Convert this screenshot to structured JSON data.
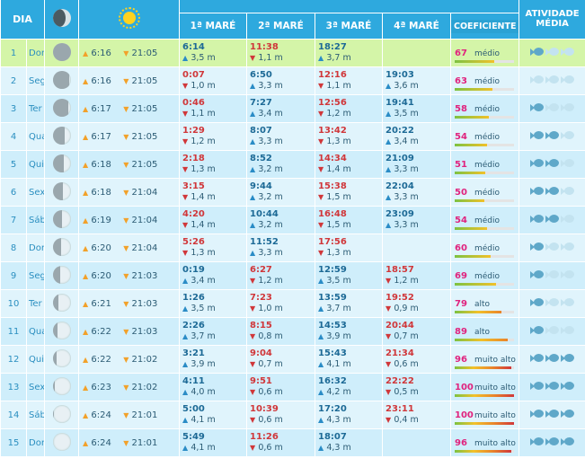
{
  "header": {
    "dia": "DIA",
    "sun_icon": "sun-icon",
    "moon_icon": "moon-icon",
    "tide_group": "",
    "tides": [
      "1ª MARÉ",
      "2ª MARÉ",
      "3ª MARÉ",
      "4ª MARÉ"
    ],
    "coeficiente": "COEFICIENTE",
    "atividade": "ATIVIDADE",
    "media": "MÉDIA"
  },
  "colors": {
    "header_bg": "#2ea9de",
    "row_bg": "#cfeefb",
    "row_alt_bg": "#e0f4fc",
    "today_bg": "#d4f5a8",
    "high_tide": "#1d6a96",
    "low_tide": "#d0373a",
    "coef_value": "#e0237e",
    "sun_arrow": "#f2a12a"
  },
  "rows": [
    {
      "num": "1",
      "wd": "Dom",
      "moon": 0.02,
      "rise": "6:16",
      "set": "21:05",
      "t": [
        {
          "time": "6:14",
          "h": "3,5 m",
          "type": "hi"
        },
        {
          "time": "11:38",
          "h": "1,1 m",
          "type": "lo"
        },
        {
          "time": "18:27",
          "h": "3,7 m",
          "type": "hi"
        },
        null
      ],
      "coef": "67",
      "level": "médio",
      "fish": 1
    },
    {
      "num": "2",
      "wd": "Seg",
      "moon": 0.08,
      "rise": "6:16",
      "set": "21:05",
      "t": [
        {
          "time": "0:07",
          "h": "1,0 m",
          "type": "lo"
        },
        {
          "time": "6:50",
          "h": "3,3 m",
          "type": "hi"
        },
        {
          "time": "12:16",
          "h": "1,1 m",
          "type": "lo"
        },
        {
          "time": "19:03",
          "h": "3,6 m",
          "type": "hi"
        }
      ],
      "coef": "63",
      "level": "médio",
      "fish": 0
    },
    {
      "num": "3",
      "wd": "Ter",
      "moon": 0.15,
      "rise": "6:17",
      "set": "21:05",
      "t": [
        {
          "time": "0:46",
          "h": "1,1 m",
          "type": "lo"
        },
        {
          "time": "7:27",
          "h": "3,4 m",
          "type": "hi"
        },
        {
          "time": "12:56",
          "h": "1,2 m",
          "type": "lo"
        },
        {
          "time": "19:41",
          "h": "3,5 m",
          "type": "hi"
        }
      ],
      "coef": "58",
      "level": "médio",
      "fish": 1
    },
    {
      "num": "4",
      "wd": "Qua",
      "moon": 0.35,
      "rise": "6:17",
      "set": "21:05",
      "t": [
        {
          "time": "1:29",
          "h": "1,2 m",
          "type": "lo"
        },
        {
          "time": "8:07",
          "h": "3,3 m",
          "type": "hi"
        },
        {
          "time": "13:42",
          "h": "1,3 m",
          "type": "lo"
        },
        {
          "time": "20:22",
          "h": "3,4 m",
          "type": "hi"
        }
      ],
      "coef": "54",
      "level": "médio",
      "fish": 2
    },
    {
      "num": "5",
      "wd": "Qui",
      "moon": 0.4,
      "rise": "6:18",
      "set": "21:05",
      "t": [
        {
          "time": "2:18",
          "h": "1,3 m",
          "type": "lo"
        },
        {
          "time": "8:52",
          "h": "3,2 m",
          "type": "hi"
        },
        {
          "time": "14:34",
          "h": "1,4 m",
          "type": "lo"
        },
        {
          "time": "21:09",
          "h": "3,3 m",
          "type": "hi"
        }
      ],
      "coef": "51",
      "level": "médio",
      "fish": 2
    },
    {
      "num": "6",
      "wd": "Sex",
      "moon": 0.45,
      "rise": "6:18",
      "set": "21:04",
      "t": [
        {
          "time": "3:15",
          "h": "1,4 m",
          "type": "lo"
        },
        {
          "time": "9:44",
          "h": "3,2 m",
          "type": "hi"
        },
        {
          "time": "15:38",
          "h": "1,5 m",
          "type": "lo"
        },
        {
          "time": "22:04",
          "h": "3,3 m",
          "type": "hi"
        }
      ],
      "coef": "50",
      "level": "médio",
      "fish": 2
    },
    {
      "num": "7",
      "wd": "Sáb",
      "moon": 0.5,
      "rise": "6:19",
      "set": "21:04",
      "t": [
        {
          "time": "4:20",
          "h": "1,4 m",
          "type": "lo"
        },
        {
          "time": "10:44",
          "h": "3,2 m",
          "type": "hi"
        },
        {
          "time": "16:48",
          "h": "1,5 m",
          "type": "lo"
        },
        {
          "time": "23:09",
          "h": "3,3 m",
          "type": "hi"
        }
      ],
      "coef": "54",
      "level": "médio",
      "fish": 2
    },
    {
      "num": "8",
      "wd": "Dom",
      "moon": 0.55,
      "rise": "6:20",
      "set": "21:04",
      "t": [
        {
          "time": "5:26",
          "h": "1,3 m",
          "type": "lo"
        },
        {
          "time": "11:52",
          "h": "3,3 m",
          "type": "hi"
        },
        {
          "time": "17:56",
          "h": "1,3 m",
          "type": "lo"
        },
        null
      ],
      "coef": "60",
      "level": "médio",
      "fish": 1
    },
    {
      "num": "9",
      "wd": "Seg",
      "moon": 0.6,
      "rise": "6:20",
      "set": "21:03",
      "t": [
        {
          "time": "0:19",
          "h": "3,4 m",
          "type": "hi"
        },
        {
          "time": "6:27",
          "h": "1,2 m",
          "type": "lo"
        },
        {
          "time": "12:59",
          "h": "3,5 m",
          "type": "hi"
        },
        {
          "time": "18:57",
          "h": "1,2 m",
          "type": "lo"
        }
      ],
      "coef": "69",
      "level": "médio",
      "fish": 1
    },
    {
      "num": "10",
      "wd": "Ter",
      "moon": 0.68,
      "rise": "6:21",
      "set": "21:03",
      "t": [
        {
          "time": "1:26",
          "h": "3,5 m",
          "type": "hi"
        },
        {
          "time": "7:23",
          "h": "1,0 m",
          "type": "lo"
        },
        {
          "time": "13:59",
          "h": "3,7 m",
          "type": "hi"
        },
        {
          "time": "19:52",
          "h": "0,9 m",
          "type": "lo"
        }
      ],
      "coef": "79",
      "level": "alto",
      "fish": 1
    },
    {
      "num": "11",
      "wd": "Qua",
      "moon": 0.75,
      "rise": "6:22",
      "set": "21:03",
      "t": [
        {
          "time": "2:26",
          "h": "3,7 m",
          "type": "hi"
        },
        {
          "time": "8:15",
          "h": "0,8 m",
          "type": "lo"
        },
        {
          "time": "14:53",
          "h": "3,9 m",
          "type": "hi"
        },
        {
          "time": "20:44",
          "h": "0,7 m",
          "type": "lo"
        }
      ],
      "coef": "89",
      "level": "alto",
      "fish": 1
    },
    {
      "num": "12",
      "wd": "Qui",
      "moon": 0.82,
      "rise": "6:22",
      "set": "21:02",
      "t": [
        {
          "time": "3:21",
          "h": "3,9 m",
          "type": "hi"
        },
        {
          "time": "9:04",
          "h": "0,7 m",
          "type": "lo"
        },
        {
          "time": "15:43",
          "h": "4,1 m",
          "type": "hi"
        },
        {
          "time": "21:34",
          "h": "0,6 m",
          "type": "lo"
        }
      ],
      "coef": "96",
      "level": "muito alto",
      "fish": 3
    },
    {
      "num": "13",
      "wd": "Sex",
      "moon": 0.88,
      "rise": "6:23",
      "set": "21:02",
      "t": [
        {
          "time": "4:11",
          "h": "4,0 m",
          "type": "hi"
        },
        {
          "time": "9:51",
          "h": "0,6 m",
          "type": "lo"
        },
        {
          "time": "16:32",
          "h": "4,2 m",
          "type": "hi"
        },
        {
          "time": "22:22",
          "h": "0,5 m",
          "type": "lo"
        }
      ],
      "coef": "100",
      "level": "muito alto",
      "fish": 3
    },
    {
      "num": "14",
      "wd": "Sáb",
      "moon": 0.94,
      "rise": "6:24",
      "set": "21:01",
      "t": [
        {
          "time": "5:00",
          "h": "4,1 m",
          "type": "hi"
        },
        {
          "time": "10:39",
          "h": "0,6 m",
          "type": "lo"
        },
        {
          "time": "17:20",
          "h": "4,3 m",
          "type": "hi"
        },
        {
          "time": "23:11",
          "h": "0,4 m",
          "type": "lo"
        }
      ],
      "coef": "100",
      "level": "muito alto",
      "fish": 3
    },
    {
      "num": "15",
      "wd": "Dom",
      "moon": 0.98,
      "rise": "6:24",
      "set": "21:01",
      "t": [
        {
          "time": "5:49",
          "h": "4,1 m",
          "type": "hi"
        },
        {
          "time": "11:26",
          "h": "0,6 m",
          "type": "lo"
        },
        {
          "time": "18:07",
          "h": "4,3 m",
          "type": "hi"
        },
        null
      ],
      "coef": "96",
      "level": "muito alto",
      "fish": 3
    }
  ]
}
